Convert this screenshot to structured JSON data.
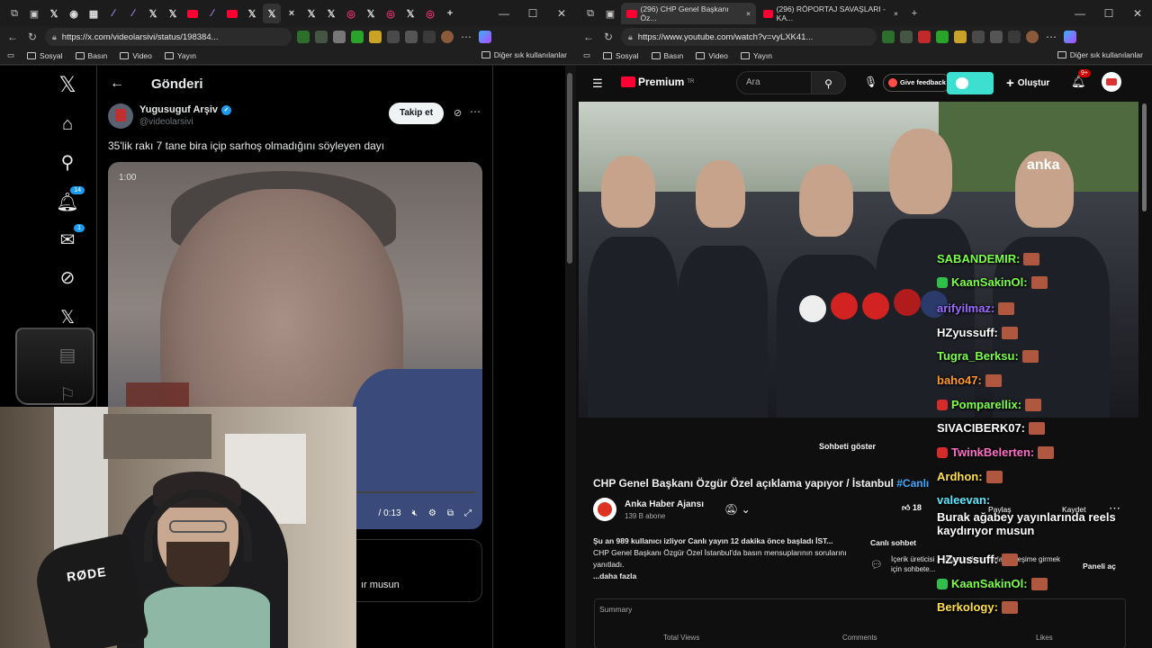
{
  "left_browser": {
    "url": "https://x.com/videolarsivi/status/198384...",
    "bookmarks": [
      "Sosyal",
      "Basın",
      "Video",
      "Yayın"
    ],
    "bookmarks_right": "Diğer sık kullanılanlar",
    "tab_icons": [
      "X",
      "X",
      "X",
      "X",
      "X",
      "X",
      "X",
      "X",
      "X",
      "X"
    ]
  },
  "x": {
    "notification_badge": "14",
    "messages_badge": "1",
    "header_title": "Gönderi",
    "author_name": "Yugusuguf Arşiv",
    "author_handle": "@videolarsivi",
    "follow_label": "Takip et",
    "tweet_text": "35'lik rakı 7 tane bira içip sarhoş olmadığını söyleyen dayı",
    "video_time": "1:00",
    "video_duration": "/ 0:13",
    "next_snippet": "ır musun"
  },
  "right_browser": {
    "tab1": "(296) CHP Genel Başkanı Öz...",
    "tab2": "(296) RÖPORTAJ SAVAŞLARI - KA...",
    "url": "https://www.youtube.com/watch?v=vyLXK41...",
    "bookmarks": [
      "Sosyal",
      "Basın",
      "Video",
      "Yayın"
    ],
    "bookmarks_right": "Diğer sık kullanılanlar"
  },
  "youtube": {
    "logo": "Premium",
    "logo_region": "TR",
    "search_placeholder": "Ara",
    "feedback": "Give feedback",
    "create": "Oluştur",
    "notif_count": "9+",
    "watermark": "anka",
    "show_chat": "Sohbeti göster",
    "title": "CHP Genel Başkanı Özgür Özel açıklama yapıyor / İstanbul",
    "hashtag": "#Canlı",
    "channel": "Anka Haber Ajansı",
    "subscribers": "139 B abone",
    "likes": "18",
    "share": "Paylaş",
    "save": "Kaydet",
    "desc_header": "Şu an 989 kullanıcı izliyor  Canlı yayın 12 dakika önce başladı  İST...",
    "desc_body": "CHP Genel Başkanı Özgür Özel İstanbul'da basın mensuplarının sorularını yanıtladı.",
    "desc_more": "...daha fazla",
    "live_chat_title": "Canlı sohbet",
    "live_chat_text": "İçerik üreticisi ... diğer kullanıcılarla etkileşime girmek için sohbete...",
    "open_panel": "Paneli aç",
    "summary": "Summary",
    "col_views": "Total Views",
    "col_comments": "Comments",
    "col_likes": "Likes"
  },
  "chat": [
    {
      "user": "SABANDEMIR:",
      "color": "#7cff4a",
      "text": ""
    },
    {
      "user": "KaanSakinOl:",
      "color": "#7cff4a",
      "text": ""
    },
    {
      "user": "arifyilmaz:",
      "color": "#9a6bff",
      "text": ""
    },
    {
      "user": "HZyussuff:",
      "color": "#ffffff",
      "text": ""
    },
    {
      "user": "Tugra_Berksu:",
      "color": "#7cff4a",
      "text": ""
    },
    {
      "user": "baho47:",
      "color": "#ff9a2a",
      "text": ""
    },
    {
      "user": "Pomparellix:",
      "color": "#7cff4a",
      "text": ""
    },
    {
      "user": "SIVACIBERK07:",
      "color": "#ffffff",
      "text": ""
    },
    {
      "user": "TwinkBelerten:",
      "color": "#ff6fc8",
      "text": ""
    },
    {
      "user": "Ardhon:",
      "color": "#ffe04a",
      "text": ""
    },
    {
      "user": "valeevan:",
      "color": "#5fe8ff",
      "text": "Burak ağabey yayınlarında reels kaydırıyor musun"
    },
    {
      "user": "HZyussuff:",
      "color": "#ffffff",
      "text": ""
    },
    {
      "user": "KaanSakinOl:",
      "color": "#7cff4a",
      "text": ""
    },
    {
      "user": "Berkology:",
      "color": "#ffe04a",
      "text": ""
    }
  ]
}
